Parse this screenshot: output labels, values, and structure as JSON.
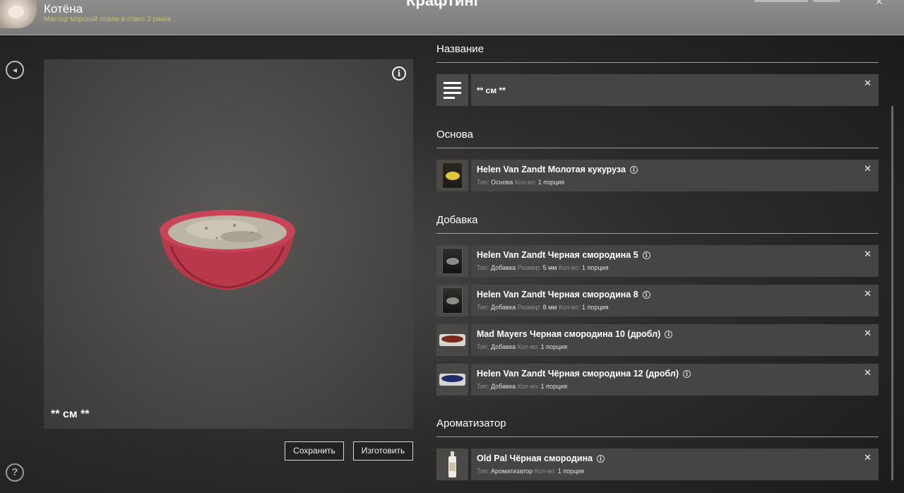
{
  "header": {
    "player_name": "Котёна",
    "player_rank": "Мастер морской ловли в отвес 2 ранга",
    "title": "Крафтинг",
    "close": "✕"
  },
  "preview": {
    "name": "** см **",
    "info": "i"
  },
  "buttons": {
    "save": "Сохранить",
    "make": "Изготовить"
  },
  "left_controls": {
    "back": "◂",
    "help": "?"
  },
  "name_section": {
    "title": "Название",
    "value": "** см **",
    "close": "✕"
  },
  "sections": [
    {
      "title": "Основа",
      "items": [
        {
          "name": "Helen Van Zandt Молотая кукуруза",
          "meta": [
            [
              "Тип:",
              "Основа"
            ],
            [
              "Кол-во:",
              "1 порция"
            ]
          ],
          "thumb": "bag-yellow"
        }
      ]
    },
    {
      "title": "Добавка",
      "items": [
        {
          "name": "Helen Van Zandt Черная смородина 5",
          "meta": [
            [
              "Тип:",
              "Добавка"
            ],
            [
              "Размер:",
              "5 мм"
            ],
            [
              "Кол-во:",
              "1 порция"
            ]
          ],
          "thumb": "bag-dark"
        },
        {
          "name": "Helen Van Zandt Черная смородина 8",
          "meta": [
            [
              "Тип:",
              "Добавка"
            ],
            [
              "Размер:",
              "8 мм"
            ],
            [
              "Кол-во:",
              "1 порция"
            ]
          ],
          "thumb": "bag-dark"
        },
        {
          "name": "Mad Mayers Черная смородина 10 (дробл)",
          "meta": [
            [
              "Тип:",
              "Добавка"
            ],
            [
              "Кол-во:",
              "1 порция"
            ]
          ],
          "thumb": "tray-red"
        },
        {
          "name": "Helen Van Zandt Чёрная смородина 12 (дробл)",
          "meta": [
            [
              "Тип:",
              "Добавка"
            ],
            [
              "Кол-во:",
              "1 порция"
            ]
          ],
          "thumb": "tray-blue"
        }
      ]
    },
    {
      "title": "Ароматизатор",
      "items": [
        {
          "name": "Old Pal Чёрная смородина",
          "meta": [
            [
              "Тип:",
              "Ароматизатор"
            ],
            [
              "Кол-во:",
              "1 порция"
            ]
          ],
          "thumb": "bottle"
        }
      ]
    }
  ],
  "icons": {
    "row_close": "✕",
    "row_info": "i"
  },
  "colors": {
    "rank_text": "#c9c35a",
    "row_bg": "#464543",
    "header_bg": "#8f8e8d"
  }
}
